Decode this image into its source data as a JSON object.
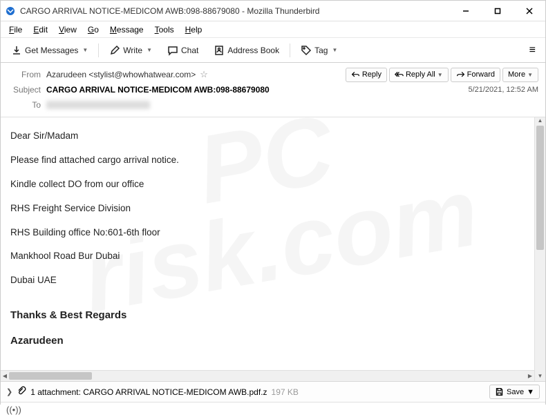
{
  "window": {
    "title": "CARGO ARRIVAL NOTICE-MEDICOM AWB:098-88679080 - Mozilla Thunderbird"
  },
  "menu": {
    "file": "File",
    "edit": "Edit",
    "view": "View",
    "go": "Go",
    "message": "Message",
    "tools": "Tools",
    "help": "Help"
  },
  "toolbar": {
    "get_messages": "Get Messages",
    "write": "Write",
    "chat": "Chat",
    "address_book": "Address Book",
    "tag": "Tag"
  },
  "header": {
    "from_label": "From",
    "from_value": "Azarudeen <stylist@whowhatwear.com>",
    "subject_label": "Subject",
    "subject_value": "CARGO ARRIVAL NOTICE-MEDICOM AWB:098-88679080",
    "to_label": "To",
    "to_value": "",
    "date": "5/21/2021, 12:52 AM",
    "reply": "Reply",
    "reply_all": "Reply All",
    "forward": "Forward",
    "more": "More"
  },
  "body": {
    "p1": "Dear Sir/Madam",
    "p2": "Please find attached cargo arrival notice.",
    "p3": "Kindle collect DO from our office",
    "p4": "RHS Freight Service Division",
    "p5": "RHS Building office No:601-6th floor",
    "p6": "Mankhool Road Bur Dubai",
    "p7": "Dubai UAE",
    "regards": "Thanks & Best Regards",
    "sig": "Azarudeen"
  },
  "attachment": {
    "label": "1 attachment: CARGO ARRIVAL NOTICE-MEDICOM AWB.pdf.z",
    "size": "197 KB",
    "save": "Save"
  }
}
